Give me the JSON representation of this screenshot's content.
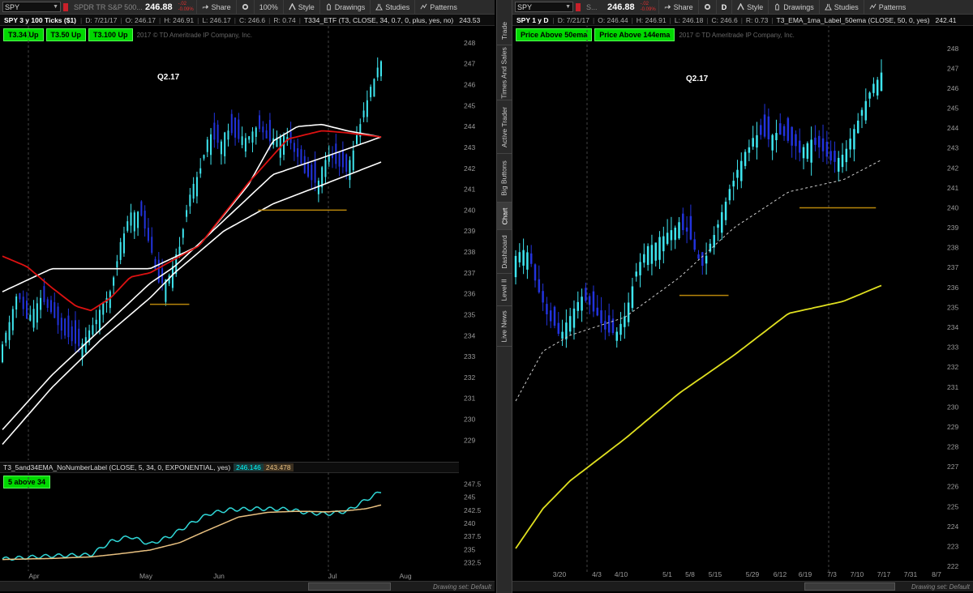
{
  "left": {
    "toolbar": {
      "symbol": "SPY",
      "description": "SPDR TR S&P 500...",
      "price": "246.88",
      "change_top": "-.02",
      "change_bottom": "-0.09%",
      "share_label": "Share",
      "zoom_label": "100%",
      "style_label": "Style",
      "drawings_label": "Drawings",
      "studies_label": "Studies",
      "patterns_label": "Patterns"
    },
    "status": {
      "title": "SPY 3 y 100 Ticks ($1)",
      "date": "D: 7/21/17",
      "open": "O: 246.17",
      "high": "H: 246.91",
      "low": "L: 246.17",
      "close": "C: 246.6",
      "range": "R: 0.74",
      "study": "T334_ETF (T3, CLOSE, 34, 0.7, 0, plus, yes, no)",
      "study_value": "243.53"
    },
    "labels": [
      "T3.34 Up",
      "T3.50 Up",
      "T3.100 Up"
    ],
    "copyright": "2017 © TD Ameritrade IP Company, Inc.",
    "quarter": "Q2.17",
    "lower": {
      "study": "T3_5and34EMA_NoNumberLabel (CLOSE, 5, 34, 0, EXPONENTIAL, yes)",
      "value1": "246.146",
      "value2": "243.478",
      "label": "5 above 34"
    },
    "drawing_set": "Drawing set: Default"
  },
  "right": {
    "toolbar": {
      "symbol": "SPY",
      "description": "S...",
      "price": "246.88",
      "change_top": "-.02",
      "change_bottom": "-0.09%",
      "share_label": "Share",
      "period_label": "D",
      "style_label": "Style",
      "drawings_label": "Drawings",
      "studies_label": "Studies",
      "patterns_label": "Patterns"
    },
    "status": {
      "title": "SPY 1 y D",
      "date": "D: 7/21/17",
      "open": "O: 246.44",
      "high": "H: 246.91",
      "low": "L: 246.18",
      "close": "C: 246.6",
      "range": "R: 0.73",
      "study": "T3_EMA_1ma_Label_50ema (CLOSE, 50, 0, yes)",
      "study_value": "242.41"
    },
    "labels": [
      "Price Above 50ema",
      "Price Above 144ema"
    ],
    "copyright": "2017 © TD Ameritrade IP Company, Inc.",
    "quarter": "Q2.17",
    "drawing_set": "Drawing set: Default"
  },
  "side_tabs": [
    "Trade",
    "Times And Sales",
    "Active Trader",
    "Big Buttons",
    "Chart",
    "Dashboard",
    "Level II",
    "Live News"
  ],
  "active_tab": "Chart",
  "colors": {
    "candle_up": "#3ee6f0",
    "candle_down": "#2233dd",
    "t3_line": "#ffffff",
    "red_line": "#dd1111",
    "ema_yellow": "#e0e020",
    "ema_dashed": "#cccccc",
    "support": "#b8860b",
    "label_green": "#00d800",
    "ema5": "#30d8d8",
    "ema34": "#e8c080"
  },
  "chart_data": [
    {
      "type": "candlestick",
      "title": "SPY 3 y 100 Ticks ($1)",
      "y_ticks": [
        229,
        230,
        231,
        232,
        233,
        234,
        235,
        236,
        237,
        238,
        239,
        240,
        241,
        242,
        243,
        244,
        245,
        246,
        247,
        248
      ],
      "x_ticks": [
        "Apr",
        "May",
        "Jun",
        "Jul",
        "Aug"
      ],
      "ylim": [
        228.2,
        248.5
      ],
      "price_path": [
        [
          0,
          233.5
        ],
        [
          3,
          236
        ],
        [
          5,
          234.8
        ],
        [
          8,
          235.8
        ],
        [
          10,
          235
        ],
        [
          13,
          234
        ],
        [
          16,
          233.5
        ],
        [
          19,
          234.8
        ],
        [
          22,
          236.2
        ],
        [
          24,
          238.4
        ],
        [
          26,
          239.8
        ],
        [
          28,
          240
        ],
        [
          30,
          238.3
        ],
        [
          32,
          236.4
        ],
        [
          34,
          236.8
        ],
        [
          36,
          238.3
        ],
        [
          38,
          240.7
        ],
        [
          40,
          241.8
        ],
        [
          42,
          243.7
        ],
        [
          44,
          243.2
        ],
        [
          46,
          243.9
        ],
        [
          48,
          243.4
        ],
        [
          50,
          243.6
        ],
        [
          52,
          244
        ],
        [
          54,
          243.3
        ],
        [
          56,
          243.5
        ],
        [
          58,
          243.6
        ],
        [
          60,
          242.5
        ],
        [
          62,
          241.6
        ],
        [
          64,
          241.3
        ],
        [
          66,
          242.7
        ],
        [
          68,
          242.2
        ],
        [
          70,
          241.8
        ],
        [
          72,
          243.5
        ],
        [
          74,
          245.2
        ],
        [
          76,
          246.6
        ],
        [
          77,
          247.2
        ]
      ],
      "lines": [
        {
          "name": "T3.34",
          "points": [
            [
              0,
              236.1
            ],
            [
              10,
              237.2
            ],
            [
              20,
              237.2
            ],
            [
              30,
              237.2
            ],
            [
              40,
              238.3
            ],
            [
              50,
              241.2
            ],
            [
              55,
              243.3
            ],
            [
              60,
              244
            ],
            [
              65,
              244.1
            ],
            [
              70,
              243.8
            ],
            [
              77,
              243.5
            ]
          ]
        },
        {
          "name": "T3.50",
          "points": [
            [
              0,
              229.5
            ],
            [
              10,
              232.1
            ],
            [
              20,
              234.3
            ],
            [
              30,
              236.5
            ],
            [
              35,
              237.3
            ],
            [
              45,
              239.5
            ],
            [
              55,
              241.7
            ],
            [
              65,
              242.5
            ],
            [
              77,
              243.5
            ]
          ]
        },
        {
          "name": "T3.100",
          "points": [
            [
              0,
              228.8
            ],
            [
              10,
              231.5
            ],
            [
              20,
              233.8
            ],
            [
              30,
              235.8
            ],
            [
              35,
              237
            ],
            [
              45,
              239
            ],
            [
              55,
              240.3
            ],
            [
              65,
              241.2
            ],
            [
              77,
              242.3
            ]
          ]
        },
        {
          "name": "red",
          "points": [
            [
              0,
              237.8
            ],
            [
              5,
              237.3
            ],
            [
              10,
              236.3
            ],
            [
              15,
              235.4
            ],
            [
              18,
              235.2
            ],
            [
              22,
              235.8
            ],
            [
              26,
              236.8
            ],
            [
              30,
              237
            ],
            [
              40,
              238.3
            ],
            [
              50,
              241.3
            ],
            [
              58,
              243.4
            ],
            [
              65,
              243.8
            ],
            [
              70,
              243.7
            ],
            [
              77,
              243.5
            ]
          ]
        }
      ],
      "support_levels": [
        {
          "x": [
            30,
            38
          ],
          "y": 235.5
        },
        {
          "x": [
            52,
            70
          ],
          "y": 240
        }
      ],
      "lower_chart": {
        "y_ticks": [
          232.5,
          235,
          237.5,
          240,
          242.5,
          245,
          247.5
        ],
        "ylim": [
          231.5,
          248.5
        ],
        "series": [
          {
            "name": "EMA5",
            "values": [
              [
                0,
                233.2
              ],
              [
                10,
                233.8
              ],
              [
                18,
                234
              ],
              [
                22,
                236.5
              ],
              [
                26,
                237.5
              ],
              [
                30,
                236
              ],
              [
                34,
                237.5
              ],
              [
                38,
                239.8
              ],
              [
                42,
                241.8
              ],
              [
                46,
                242.6
              ],
              [
                52,
                242.8
              ],
              [
                58,
                242.7
              ],
              [
                62,
                242
              ],
              [
                66,
                241.8
              ],
              [
                70,
                242.3
              ],
              [
                74,
                244.5
              ],
              [
                77,
                246.1
              ]
            ]
          },
          {
            "name": "EMA34",
            "values": [
              [
                0,
                233.1
              ],
              [
                10,
                233.3
              ],
              [
                18,
                233.6
              ],
              [
                24,
                234.2
              ],
              [
                30,
                234.9
              ],
              [
                36,
                236.3
              ],
              [
                42,
                238.8
              ],
              [
                48,
                241.2
              ],
              [
                54,
                242.1
              ],
              [
                60,
                242.3
              ],
              [
                66,
                242.2
              ],
              [
                70,
                242.4
              ],
              [
                74,
                242.8
              ],
              [
                77,
                243.5
              ]
            ]
          }
        ]
      }
    },
    {
      "type": "candlestick",
      "title": "SPY 1 y D",
      "y_ticks": [
        222,
        223,
        224,
        225,
        226,
        227,
        228,
        229,
        230,
        231,
        232,
        233,
        234,
        235,
        236,
        237,
        238,
        239,
        240,
        241,
        242,
        243,
        244,
        245,
        246,
        247,
        248
      ],
      "x_ticks": [
        "3/20",
        "4/3",
        "4/10",
        "5/1",
        "5/8",
        "5/15",
        "5/29",
        "6/12",
        "6/19",
        "7/3",
        "7/10",
        "7/17",
        "7/31",
        "8/7"
      ],
      "ylim": [
        221.8,
        248.6
      ],
      "price_path": [
        [
          0,
          237.5
        ],
        [
          2,
          238
        ],
        [
          4,
          236
        ],
        [
          6,
          234.5
        ],
        [
          8,
          233.6
        ],
        [
          10,
          234.5
        ],
        [
          12,
          235.5
        ],
        [
          14,
          235
        ],
        [
          16,
          234
        ],
        [
          18,
          233.6
        ],
        [
          20,
          234.5
        ],
        [
          22,
          236.8
        ],
        [
          24,
          238
        ],
        [
          26,
          238.4
        ],
        [
          28,
          238.8
        ],
        [
          30,
          239.2
        ],
        [
          32,
          238.5
        ],
        [
          34,
          237
        ],
        [
          36,
          238.4
        ],
        [
          38,
          240
        ],
        [
          40,
          241.5
        ],
        [
          42,
          242.7
        ],
        [
          44,
          243.7
        ],
        [
          46,
          243.5
        ],
        [
          48,
          243.7
        ],
        [
          50,
          243.4
        ],
        [
          52,
          242.8
        ],
        [
          54,
          243.4
        ],
        [
          56,
          243
        ],
        [
          58,
          242.2
        ],
        [
          60,
          242.6
        ],
        [
          62,
          244
        ],
        [
          64,
          245.3
        ],
        [
          66,
          246.4
        ],
        [
          67,
          246.8
        ]
      ],
      "lines": [
        {
          "name": "EMA50",
          "style": "dashed",
          "points": [
            [
              0,
              230.3
            ],
            [
              5,
              232.8
            ],
            [
              10,
              233.6
            ],
            [
              20,
              234.5
            ],
            [
              30,
              236.5
            ],
            [
              40,
              239
            ],
            [
              50,
              240.8
            ],
            [
              60,
              241.4
            ],
            [
              67,
              242.4
            ]
          ]
        },
        {
          "name": "EMA144",
          "points": [
            [
              0,
              222.9
            ],
            [
              5,
              224.9
            ],
            [
              10,
              226.3
            ],
            [
              20,
              228.4
            ],
            [
              30,
              230.7
            ],
            [
              40,
              232.6
            ],
            [
              50,
              234.7
            ],
            [
              60,
              235.3
            ],
            [
              67,
              236.1
            ]
          ]
        }
      ],
      "support_levels": [
        {
          "x": [
            30,
            39
          ],
          "y": 235.6
        },
        {
          "x": [
            52,
            66
          ],
          "y": 240
        }
      ]
    }
  ]
}
